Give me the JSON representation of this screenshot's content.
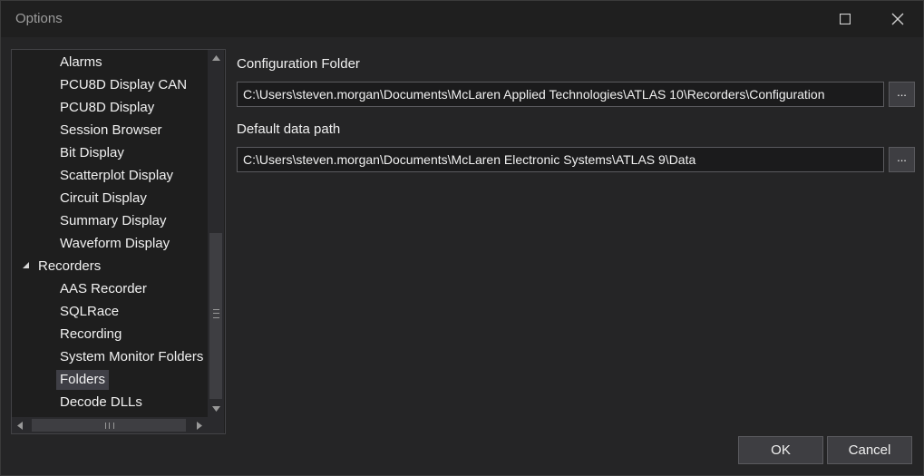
{
  "window": {
    "title": "Options"
  },
  "tree": {
    "items": [
      {
        "label": "Alarms",
        "level": 2
      },
      {
        "label": "PCU8D Display CAN",
        "level": 2
      },
      {
        "label": "PCU8D Display",
        "level": 2
      },
      {
        "label": "Session Browser",
        "level": 2
      },
      {
        "label": "Bit Display",
        "level": 2
      },
      {
        "label": "Scatterplot Display",
        "level": 2
      },
      {
        "label": "Circuit Display",
        "level": 2
      },
      {
        "label": "Summary Display",
        "level": 2
      },
      {
        "label": "Waveform Display",
        "level": 2
      },
      {
        "label": "Recorders",
        "level": 1,
        "expanded": true
      },
      {
        "label": "AAS Recorder",
        "level": 2
      },
      {
        "label": "SQLRace",
        "level": 2
      },
      {
        "label": "Recording",
        "level": 2
      },
      {
        "label": "System Monitor Folders",
        "level": 2
      },
      {
        "label": "Folders",
        "level": 2,
        "selected": true
      },
      {
        "label": "Decode DLLs",
        "level": 2
      }
    ]
  },
  "config": {
    "label": "Configuration Folder",
    "value": "C:\\Users\\steven.morgan\\Documents\\McLaren Applied Technologies\\ATLAS 10\\Recorders\\Configuration",
    "browse_label": "..."
  },
  "datapath": {
    "label": "Default data path",
    "value": "C:\\Users\\steven.morgan\\Documents\\McLaren Electronic Systems\\ATLAS 9\\Data",
    "browse_label": "..."
  },
  "buttons": {
    "ok_label": "OK",
    "cancel_label": "Cancel"
  },
  "icons": {
    "maximize": "maximize-icon",
    "close": "close-icon",
    "expander": "triangle-expanded-icon"
  },
  "colors": {
    "background": "#252526",
    "titlebar": "#1f1f1f",
    "selection": "#3f3f46",
    "button": "#3e3e42"
  }
}
